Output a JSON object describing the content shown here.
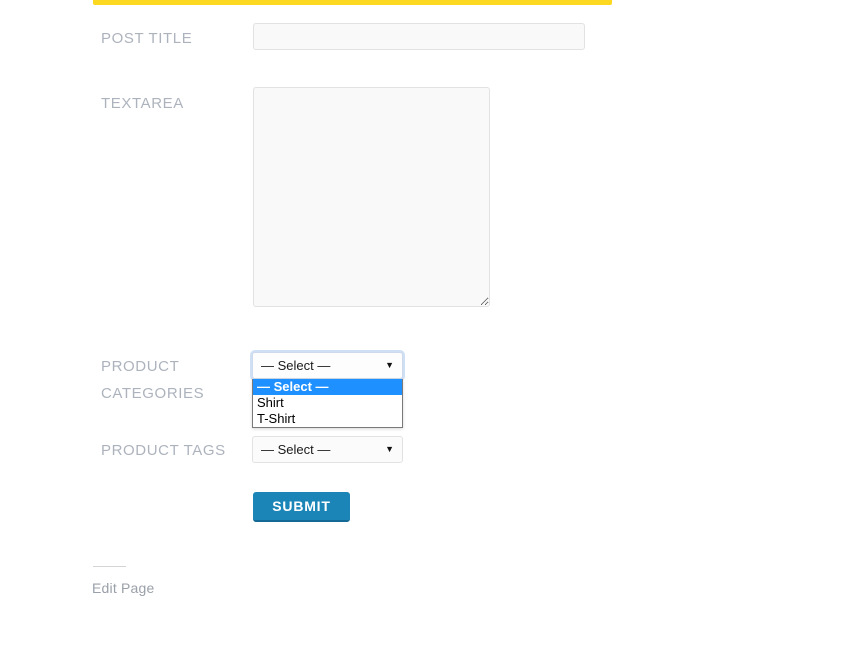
{
  "theme": {
    "accent_bar_color": "#fcd920",
    "submit_color": "#1b85b8",
    "submit_shadow_color": "#146a94",
    "option_highlight_color": "#1e90ff",
    "label_color": "#adb3bd",
    "field_background": "#f9f9f9",
    "page_background": "#ffffff"
  },
  "form": {
    "post_title": {
      "label": "POST TITLE",
      "value": "",
      "placeholder": ""
    },
    "textarea": {
      "label": "TEXTAREA",
      "value": "",
      "placeholder": ""
    },
    "product_categories": {
      "label_line1": "PRODUCT",
      "label_line2": "CATEGORIES",
      "selected": "— Select —",
      "expanded": true,
      "options": [
        {
          "label": "— Select —",
          "selected": true
        },
        {
          "label": "Shirt",
          "selected": false
        },
        {
          "label": "T-Shirt",
          "selected": false
        }
      ]
    },
    "product_tags": {
      "label": "PRODUCT TAGS",
      "selected": "— Select —",
      "expanded": false,
      "options": [
        {
          "label": "— Select —",
          "selected": true
        }
      ]
    },
    "submit": {
      "label": "SUBMIT"
    }
  },
  "footer": {
    "edit_page_label": "Edit Page"
  },
  "icons": {
    "caret_down": "▼",
    "resize_handle": "resize-handle-icon"
  }
}
